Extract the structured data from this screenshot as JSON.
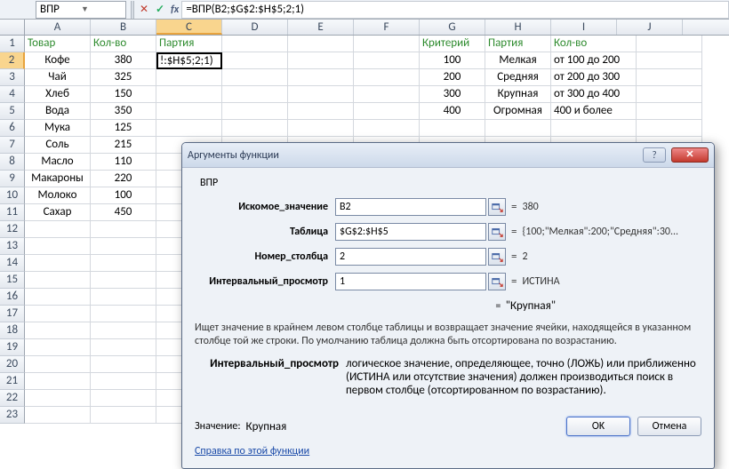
{
  "name_box": "ВПР",
  "formula": "=ВПР(B2;$G$2:$H$5;2;1)",
  "columns": [
    "A",
    "B",
    "C",
    "D",
    "E",
    "F",
    "G",
    "H",
    "I",
    "J"
  ],
  "active_col": "C",
  "active_row": 2,
  "rows_count": 23,
  "headers": {
    "A": "Товар",
    "B": "Кол-во",
    "C": "Партия",
    "G": "Критерий",
    "H": "Партия",
    "I": "Кол-во"
  },
  "data_left": [
    {
      "A": "Кофе",
      "B": "380"
    },
    {
      "A": "Чай",
      "B": "325"
    },
    {
      "A": "Хлеб",
      "B": "150"
    },
    {
      "A": "Вода",
      "B": "350"
    },
    {
      "A": "Мука",
      "B": "125"
    },
    {
      "A": "Соль",
      "B": "215"
    },
    {
      "A": "Масло",
      "B": "110"
    },
    {
      "A": "Макароны",
      "B": "220"
    },
    {
      "A": "Молоко",
      "B": "100"
    },
    {
      "A": "Сахар",
      "B": "450"
    }
  ],
  "data_right": [
    {
      "G": "100",
      "H": "Мелкая",
      "I": "от 100 до 200"
    },
    {
      "G": "200",
      "H": "Средняя",
      "I": "от 200 до 300"
    },
    {
      "G": "300",
      "H": "Крупная",
      "I": "от 300 до 400"
    },
    {
      "G": "400",
      "H": "Огромная",
      "I": "400 и более"
    }
  ],
  "c2_display": "!:$H$5;2;1)",
  "dialog": {
    "title": "Аргументы функции",
    "func": "ВПР",
    "args": [
      {
        "label": "Искомое_значение",
        "value": "B2",
        "result": "380"
      },
      {
        "label": "Таблица",
        "value": "$G$2:$H$5",
        "result": "{100;\"Мелкая\":200;\"Средняя\":30..."
      },
      {
        "label": "Номер_столбца",
        "value": "2",
        "result": "2"
      },
      {
        "label": "Интервальный_просмотр",
        "value": "1",
        "result": "ИСТИНА"
      }
    ],
    "formula_result": "\"Крупная\"",
    "desc": "Ищет значение в крайнем левом столбце таблицы и возвращает значение ячейки, находящейся в указанном столбце той же строки. По умолчанию таблица должна быть отсортирована по возрастанию.",
    "arg_help_label": "Интервальный_просмотр",
    "arg_help_text": "логическое значение, определяющее, точно (ЛОЖЬ) или приближенно (ИСТИНА или отсутствие значения) должен производиться поиск в первом столбце (отсортированном по возрастанию).",
    "value_label": "Значение:",
    "value": "Крупная",
    "help_link": "Справка по этой функции",
    "ok": "OK",
    "cancel": "Отмена"
  }
}
